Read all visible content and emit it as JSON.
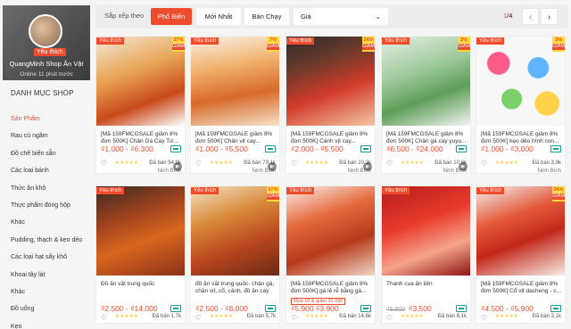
{
  "shop": {
    "name": "QuangMinh Shop Ăn Vặt",
    "favorite_badge": "Yêu thích",
    "online": "Online 11 phút trước"
  },
  "categories": {
    "title": "DANH MỤC SHOP",
    "items": [
      "Sản Phẩm",
      "Rau củ ngâm",
      "Đồ chế biến sẵn",
      "Các loại bánh",
      "Thức ăn khô",
      "Thực phẩm đóng hộp",
      "Khác",
      "Pudding, thạch & kẹo dẻo",
      "Các loại hạt sấy khô",
      "Khoai tây lát",
      "Khác",
      "Đồ uống",
      "Kẹo"
    ]
  },
  "sortbar": {
    "label": "Sắp xếp theo",
    "buttons": [
      "Phổ Biến",
      "Mới Nhất",
      "Bán Chạy"
    ],
    "price_label": "Giá",
    "page_current": "1",
    "page_total": "/4",
    "prev_icon": "‹",
    "next_icon": "›"
  },
  "products": [
    {
      "badge": "Yêu thích",
      "discount": "37%",
      "discount_word": "GIẢM",
      "title": "[Mã 159FMCGSALE giảm 8% đơn 500K] Chân Gà Cay Tứ...",
      "price": "₫1.000 - ₫6.300",
      "sold": "Đã bán 94,9k",
      "location": "Ninh Bình"
    },
    {
      "badge": "Yêu thích",
      "discount": "7%",
      "discount_word": "GIẢM",
      "title": "[Mã 159FMCGSALE giảm 8% đơn 500K] Chân vịt cay...",
      "price": "₫1.000 - ₫5.500",
      "sold": "Đã bán 79,1k",
      "location": "Ninh Bình"
    },
    {
      "badge": "Yêu thích",
      "discount": "24%",
      "discount_word": "GIẢM",
      "title": "[Mã 159FMCGSALE giảm 8% đơn 500K] Cánh vịt cay...",
      "price": "₫2.000 - ₫5.500",
      "sold": "Đã bán 20,3k",
      "location": "Ninh Bình"
    },
    {
      "badge": "Yêu thích",
      "discount": "2%",
      "discount_word": "GIẢM",
      "title": "[Mã 159FMCGSALE giảm 8% đơn 500K] Chân gà cay yuyu...",
      "price": "₫6.500 - ₫24.000",
      "sold": "Đã bán 10,8k",
      "location": "Ninh Bình"
    },
    {
      "badge": "Yêu thích",
      "discount": "3%",
      "discount_word": "GIẢM",
      "title": "[Mã 159FMCGSALE giảm 8% đơn 500K] kẹo dẻo hình con...",
      "price": "₫1.000 - ₫3.000",
      "sold": "Đã bán 3,9k",
      "location": "Ninh Bình"
    },
    {
      "badge": "Yêu thích",
      "discount": "",
      "discount_word": "",
      "title": "Đồ ăn vặt trung quốc",
      "price": "₫2.500 - ₫14.000",
      "sold": "Đã bán 1,7k",
      "location": ""
    },
    {
      "badge": "Yêu thích",
      "discount": "17%",
      "discount_word": "GIẢM",
      "title": "đồ ăn vặt trung quốc- chân gà, chân vịt, cổ, cánh, đồ ăn cay",
      "price": "₫2.500 - ₫8.000",
      "sold": "Đã bán 5,7k",
      "location": ""
    },
    {
      "badge": "Yêu thích",
      "discount": "",
      "discount_word": "",
      "title": "[Mã 159FMCGSALE giảm 8% đơn 500K] gà lê rễ bằng gà...",
      "promo": "Mua 10 & giảm 32.000",
      "price": "₫5.900 ₫3.900",
      "sold": "Đã bán 14,6k",
      "location": ""
    },
    {
      "badge": "Yêu thích",
      "discount": "",
      "discount_word": "",
      "title": "Thanh cua ăn liền",
      "old_price": "₫5.000",
      "price": "₫3.500",
      "sold": "Đã bán 8,1k",
      "location": ""
    },
    {
      "badge": "Yêu thích",
      "discount": "34%",
      "discount_word": "GIẢM",
      "title": "[Mã 159FMCGSALE giảm 8% đơn 500K] Cổ vịt dacheng - c...",
      "price": "₫4.500 - ₫5.900",
      "sold": "Đã bán 3,1k",
      "location": ""
    }
  ],
  "colors": {
    "brand": "#ee4d2d",
    "rating": "#ffce3d",
    "free_ship": "#1a9f9c"
  }
}
